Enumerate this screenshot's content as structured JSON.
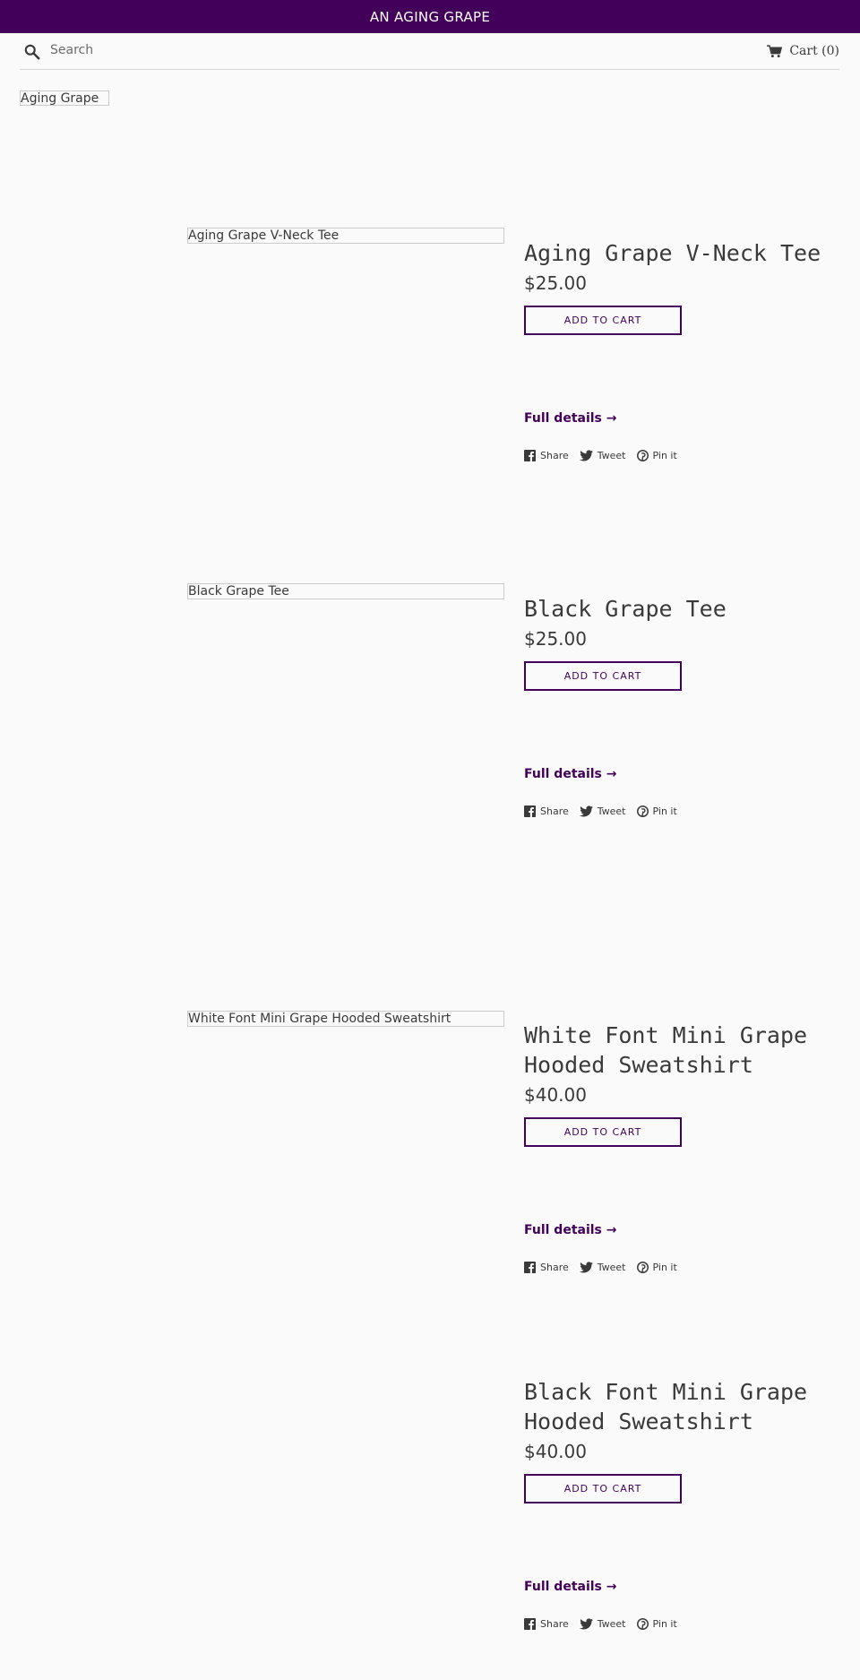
{
  "announcement": {
    "text": "AN AGING GRAPE"
  },
  "header": {
    "search_placeholder": "Search",
    "cart_label": "Cart (0)"
  },
  "collection": {
    "image_alt": "Aging Grape"
  },
  "share_labels": {
    "share": "Share",
    "tweet": "Tweet",
    "pin": "Pin it"
  },
  "products": [
    {
      "image_alt": "Aging Grape V-Neck Tee",
      "title": "Aging Grape V-Neck Tee",
      "price": "$25.00",
      "add_to_cart": "ADD TO CART",
      "details_link": "Full details →"
    },
    {
      "image_alt": "Black Grape Tee",
      "title": "Black Grape Tee",
      "price": "$25.00",
      "add_to_cart": "ADD TO CART",
      "details_link": "Full details →"
    },
    {
      "image_alt": "White Font Mini Grape Hooded Sweatshirt",
      "title": "White Font Mini Grape Hooded Sweatshirt",
      "price": "$40.00",
      "add_to_cart": "ADD TO CART",
      "details_link": "Full details →"
    },
    {
      "title": "Black Font Mini Grape Hooded Sweatshirt",
      "price": "$40.00",
      "add_to_cart": "ADD TO CART",
      "details_link": "Full details →"
    }
  ],
  "colors": {
    "accent": "#42005a",
    "background": "#fafafa",
    "text": "#3a3a3a"
  },
  "icons": [
    "search-icon",
    "cart-icon",
    "facebook-icon",
    "twitter-icon",
    "pinterest-icon"
  ]
}
